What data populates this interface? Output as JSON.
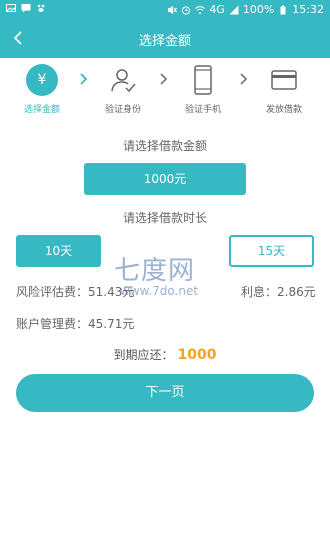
{
  "status_bar": {
    "battery": "100%",
    "time": "15:32",
    "network": "4G",
    "icons": [
      "image-icon",
      "message-icon",
      "paw-icon",
      "mute-icon",
      "alarm-icon",
      "wifi-icon",
      "signal-icon",
      "battery-icon"
    ]
  },
  "header": {
    "title": "选择金额"
  },
  "steps": [
    {
      "label": "选择金额",
      "icon": "yen-icon"
    },
    {
      "label": "验证身份",
      "icon": "user-check-icon"
    },
    {
      "label": "验证手机",
      "icon": "phone-icon"
    },
    {
      "label": "发放借款",
      "icon": "card-icon"
    }
  ],
  "step_active_symbol": "¥",
  "amount": {
    "prompt": "请选择借款金额",
    "selected": "1000元"
  },
  "duration": {
    "prompt": "请选择借款时长",
    "options": [
      "10天",
      "15天"
    ]
  },
  "fees": {
    "risk_label": "风险评估费：",
    "risk_value": "51.43元",
    "interest_label": "利息：",
    "interest_value": "2.86元",
    "account_label": "账户管理费：",
    "account_value": "45.71元"
  },
  "due": {
    "label": "到期应还：",
    "value": "1000"
  },
  "watermark": {
    "big": "七度网",
    "small": "www.7do.net"
  },
  "next_button": "下一页",
  "colors": {
    "accent": "#37b9c3",
    "due_value": "#f2a51a"
  }
}
